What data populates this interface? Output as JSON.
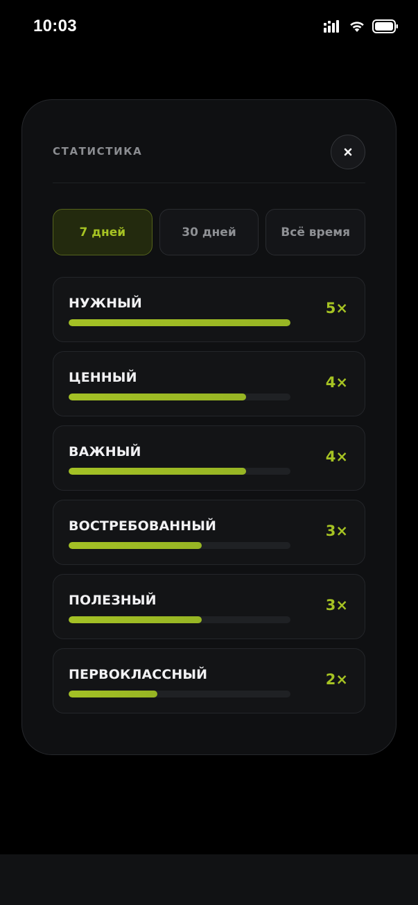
{
  "status_bar": {
    "time": "10:03"
  },
  "modal": {
    "title": "СТАТИСТИКА",
    "close_label": "×"
  },
  "tabs": [
    {
      "label": "7 дней",
      "active": true
    },
    {
      "label": "30 дней",
      "active": false
    },
    {
      "label": "Всё время",
      "active": false
    }
  ],
  "stats": [
    {
      "label": "НУЖНЫЙ",
      "count": "5×",
      "value": 5
    },
    {
      "label": "ЦЕННЫЙ",
      "count": "4×",
      "value": 4
    },
    {
      "label": "ВАЖНЫЙ",
      "count": "4×",
      "value": 4
    },
    {
      "label": "ВОСТРЕБОВАННЫЙ",
      "count": "3×",
      "value": 3
    },
    {
      "label": "ПОЛЕЗНЫЙ",
      "count": "3×",
      "value": 3
    },
    {
      "label": "ПЕРВОКЛАССНЫЙ",
      "count": "2×",
      "value": 2
    }
  ],
  "colors": {
    "accent": "#a6c323",
    "background": "#000000",
    "card": "#131416",
    "text": "#f1f1f3",
    "muted": "#8b8d91"
  },
  "icons": [
    "cellular-signal-icon",
    "wifi-icon",
    "battery-icon",
    "close-icon"
  ]
}
